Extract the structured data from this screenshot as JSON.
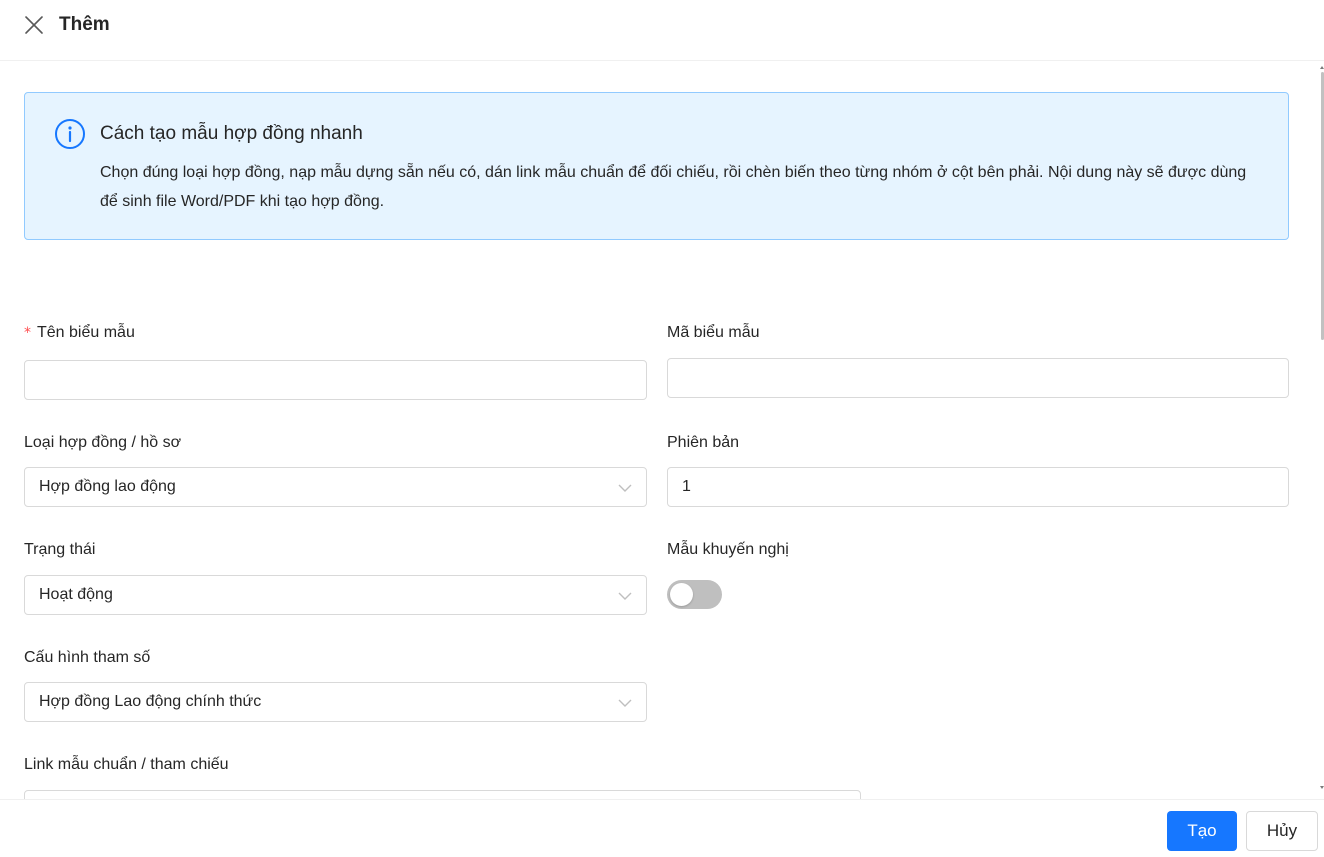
{
  "header": {
    "title": "Thêm"
  },
  "alert": {
    "title": "Cách tạo mẫu hợp đồng nhanh",
    "description": "Chọn đúng loại hợp đồng, nạp mẫu dựng sẵn nếu có, dán link mẫu chuẩn để đối chiếu, rồi chèn biến theo từng nhóm ở cột bên phải. Nội dung này sẽ được dùng để sinh file Word/PDF khi tạo hợp đồng.",
    "icon": "info-circle-icon"
  },
  "form": {
    "template_name": {
      "label": "Tên biểu mẫu",
      "required_mark": "*",
      "value": "",
      "placeholder": ""
    },
    "template_code": {
      "label": "Mã biểu mẫu",
      "value": "",
      "placeholder": ""
    },
    "contract_type": {
      "label": "Loại hợp đồng / hồ sơ",
      "value": "Hợp đồng lao động"
    },
    "version": {
      "label": "Phiên bản",
      "value": "1"
    },
    "status": {
      "label": "Trạng thái",
      "value": "Hoạt động"
    },
    "recommended": {
      "label": "Mẫu khuyến nghị",
      "checked": false
    },
    "param_config": {
      "label": "Cấu hình tham số",
      "value": "Hợp đồng Lao động chính thức"
    },
    "reference_link": {
      "label": "Link mẫu chuẩn / tham chiếu",
      "value": ""
    }
  },
  "footer": {
    "create_label": "Tạo",
    "cancel_label": "Hủy"
  },
  "colors": {
    "primary": "#1677ff",
    "alert_bg": "#e6f4ff",
    "alert_border": "#91caff",
    "required": "#ff4d4f",
    "switch_off": "#bfbfbf"
  }
}
